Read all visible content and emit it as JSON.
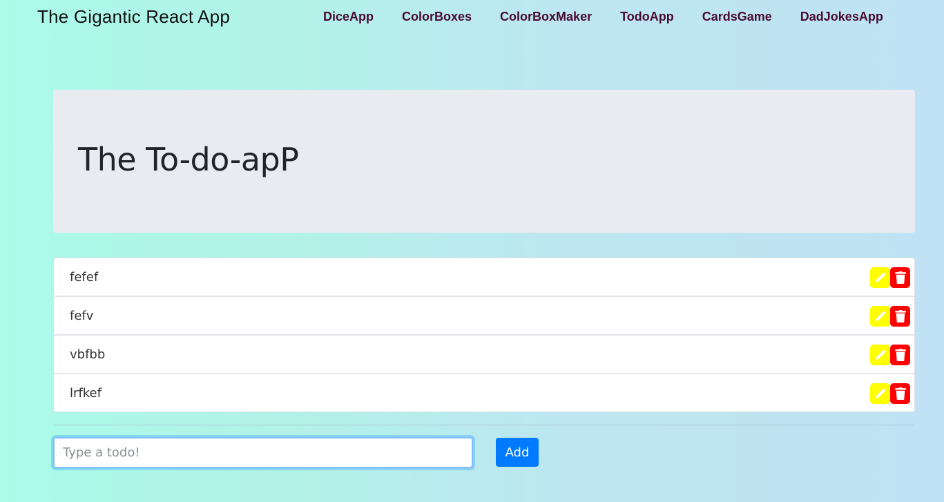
{
  "navbar": {
    "brand": "The Gigantic React App",
    "links": [
      "DiceApp",
      "ColorBoxes",
      "ColorBoxMaker",
      "TodoApp",
      "CardsGame",
      "DadJokesApp"
    ]
  },
  "jumbotron": {
    "title": "The To-do-apP"
  },
  "todos": [
    {
      "text": "fefef"
    },
    {
      "text": "fefv"
    },
    {
      "text": "vbfbb"
    },
    {
      "text": "lrfkef"
    }
  ],
  "form": {
    "input_placeholder": "Type a todo!",
    "input_value": "",
    "add_label": "Add"
  },
  "icons": {
    "edit": "pencil-icon",
    "delete": "trash-icon"
  },
  "colors": {
    "nav_link": "#4a0a32",
    "edit_button": "#ffff00",
    "delete_button": "#ff0000",
    "add_button": "#007bff"
  }
}
